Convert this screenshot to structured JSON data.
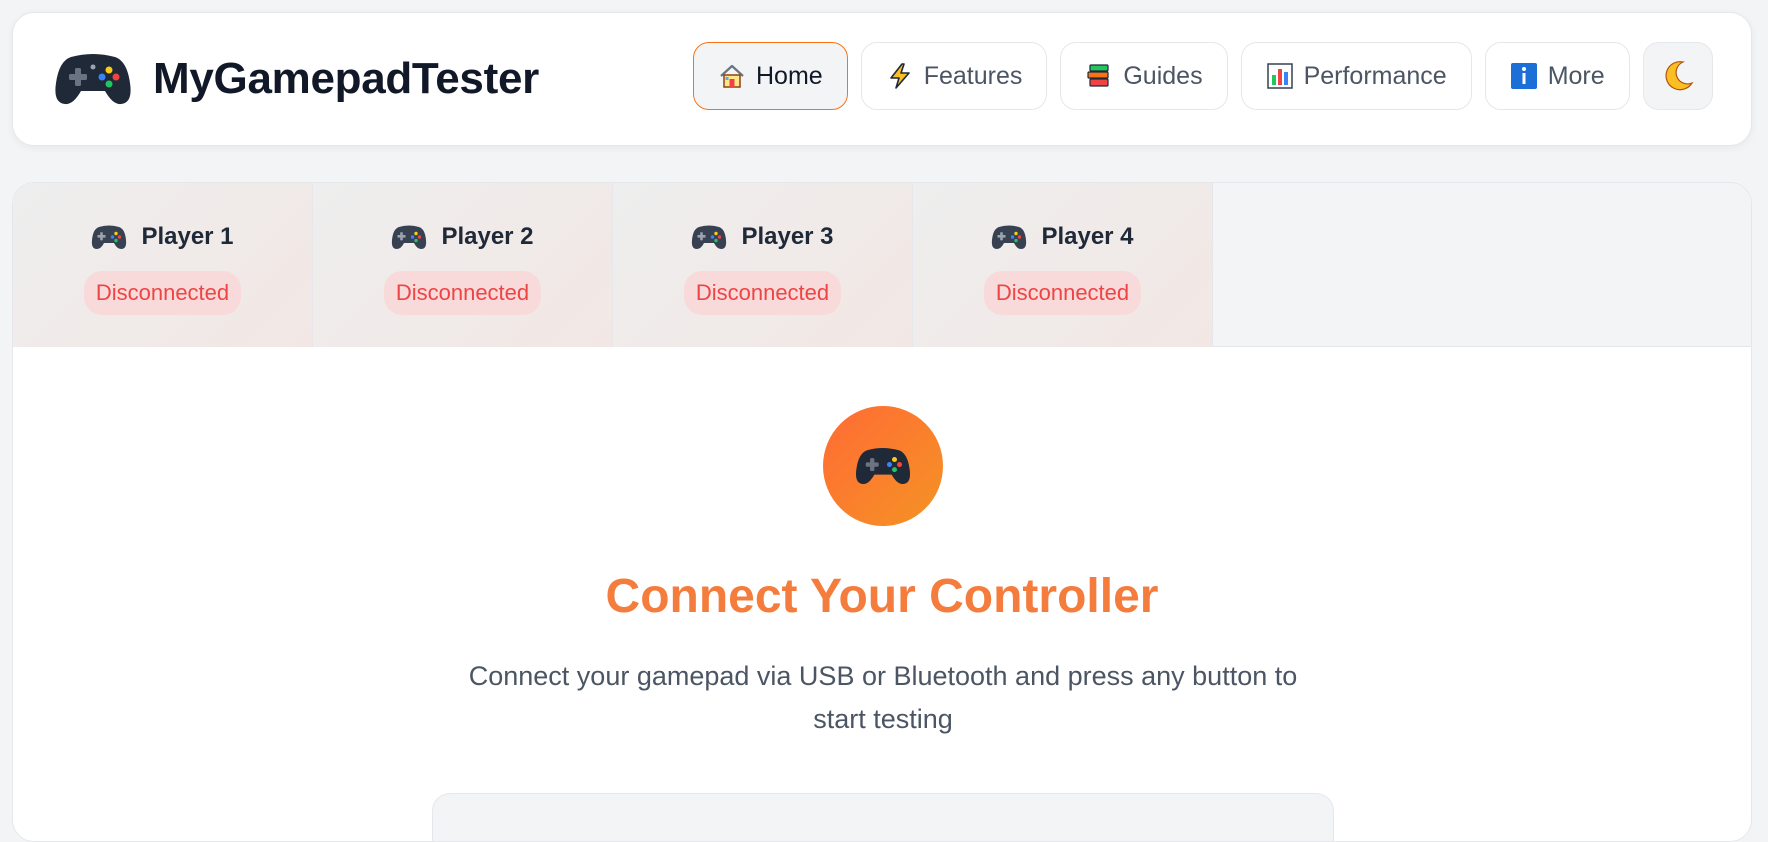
{
  "header": {
    "brand_title": "MyGamepadTester",
    "brand_icon": "gamepad-icon",
    "nav": [
      {
        "label": "Home",
        "icon": "home-icon",
        "active": true
      },
      {
        "label": "Features",
        "icon": "lightning-icon",
        "active": false
      },
      {
        "label": "Guides",
        "icon": "books-icon",
        "active": false
      },
      {
        "label": "Performance",
        "icon": "bar-chart-icon",
        "active": false
      },
      {
        "label": "More",
        "icon": "info-icon",
        "active": false
      }
    ],
    "theme_toggle_icon": "moon-icon"
  },
  "players": [
    {
      "label": "Player 1",
      "status": "Disconnected"
    },
    {
      "label": "Player 2",
      "status": "Disconnected"
    },
    {
      "label": "Player 3",
      "status": "Disconnected"
    },
    {
      "label": "Player 4",
      "status": "Disconnected"
    }
  ],
  "hero": {
    "icon": "gamepad-icon",
    "title": "Connect Your Controller",
    "description": "Connect your gamepad via USB or Bluetooth and press any button to start testing"
  },
  "colors": {
    "accent": "#f47c3c",
    "accent_gradient_start": "#ff6b35",
    "accent_gradient_end": "#f59324",
    "disconnected_text": "#ef4444",
    "disconnected_bg": "#f8dada",
    "active_border": "#f97316"
  }
}
